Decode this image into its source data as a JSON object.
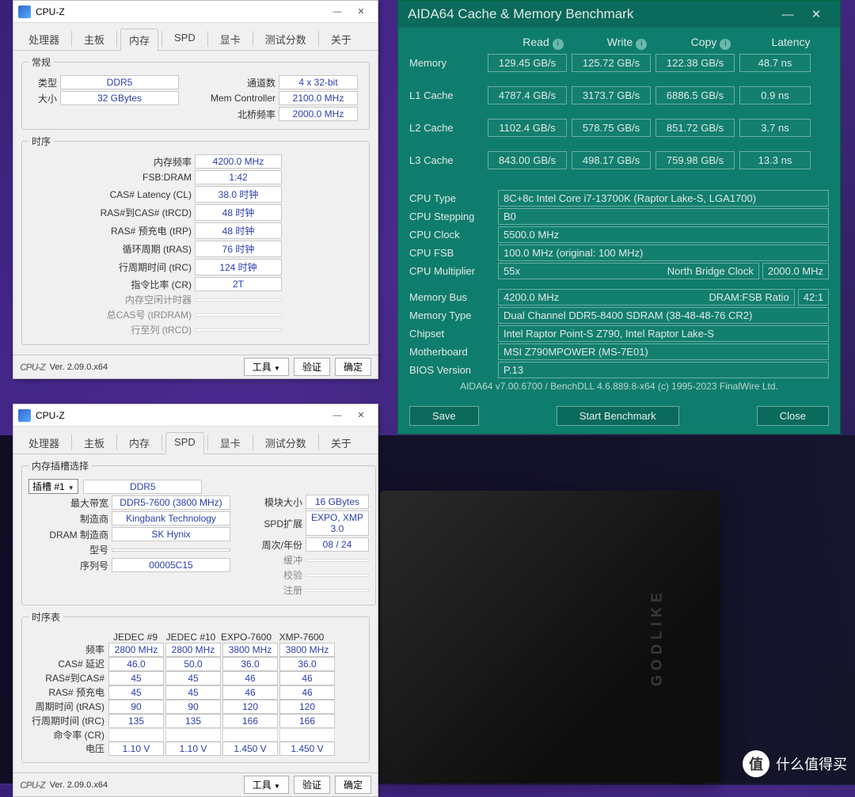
{
  "cpuz1": {
    "title": "CPU-Z",
    "tabs": [
      "处理器",
      "主板",
      "内存",
      "SPD",
      "显卡",
      "测试分数",
      "关于"
    ],
    "active_tab": "内存",
    "general": {
      "legend": "常规",
      "type_lbl": "类型",
      "type": "DDR5",
      "size_lbl": "大小",
      "size": "32 GBytes",
      "channels_lbl": "通道数",
      "channels": "4 x 32-bit",
      "mc_lbl": "Mem Controller",
      "mc": "2100.0 MHz",
      "nb_lbl": "北桥频率",
      "nb": "2000.0 MHz"
    },
    "timings": {
      "legend": "时序",
      "freq_lbl": "内存频率",
      "freq": "4200.0 MHz",
      "fsb_lbl": "FSB:DRAM",
      "fsb": "1:42",
      "cl_lbl": "CAS# Latency (CL)",
      "cl": "38.0 时钟",
      "trcd_lbl": "RAS#到CAS# (tRCD)",
      "trcd": "48 时钟",
      "trp_lbl": "RAS# 预充电 (tRP)",
      "trp": "48 时钟",
      "tras_lbl": "循环周期 (tRAS)",
      "tras": "76 时钟",
      "trc_lbl": "行周期时间 (tRC)",
      "trc": "124 时钟",
      "cr_lbl": "指令比率 (CR)",
      "cr": "2T",
      "idle_lbl": "内存空闲计时器",
      "idle": "",
      "tcas_lbl": "总CAS号 (tRDRAM)",
      "tcas": "",
      "rtc_lbl": "行至列 (tRCD)",
      "rtc": ""
    },
    "footer": {
      "logo": "CPU-Z",
      "ver": "Ver. 2.09.0.x64",
      "tools": "工具",
      "validate": "验证",
      "ok": "确定"
    }
  },
  "cpuz2": {
    "title": "CPU-Z",
    "tabs": [
      "处理器",
      "主板",
      "内存",
      "SPD",
      "显卡",
      "测试分数",
      "关于"
    ],
    "active_tab": "SPD",
    "slot": {
      "legend": "内存插槽选择",
      "slot": "插槽 #1",
      "type": "DDR5",
      "maxbw_lbl": "最大带宽",
      "maxbw": "DDR5-7600 (3800 MHz)",
      "mfg_lbl": "制造商",
      "mfg": "Kingbank Technology",
      "dram_lbl": "DRAM 制造商",
      "dram": "SK Hynix",
      "part_lbl": "型号",
      "part": "",
      "serial_lbl": "序列号",
      "serial": "00005C15",
      "modsize_lbl": "模块大小",
      "modsize": "16 GBytes",
      "spdext_lbl": "SPD扩展",
      "spdext": "EXPO, XMP 3.0",
      "week_lbl": "周次/年份",
      "week": "08 / 24",
      "buf_lbl": "缓冲",
      "ecc_lbl": "校验",
      "reg_lbl": "注册"
    },
    "tt": {
      "legend": "时序表",
      "headers": [
        "JEDEC #9",
        "JEDEC #10",
        "EXPO-7600",
        "XMP-7600"
      ],
      "rows": [
        {
          "n": "频率",
          "v": [
            "2800 MHz",
            "2800 MHz",
            "3800 MHz",
            "3800 MHz"
          ]
        },
        {
          "n": "CAS# 延迟",
          "v": [
            "46.0",
            "50.0",
            "36.0",
            "36.0"
          ]
        },
        {
          "n": "RAS#到CAS#",
          "v": [
            "45",
            "45",
            "46",
            "46"
          ]
        },
        {
          "n": "RAS# 预充电",
          "v": [
            "45",
            "45",
            "46",
            "46"
          ]
        },
        {
          "n": "周期时间 (tRAS)",
          "v": [
            "90",
            "90",
            "120",
            "120"
          ]
        },
        {
          "n": "行周期时间 (tRC)",
          "v": [
            "135",
            "135",
            "166",
            "166"
          ]
        },
        {
          "n": "命令率 (CR)",
          "v": [
            "",
            "",
            "",
            ""
          ]
        },
        {
          "n": "电压",
          "v": [
            "1.10 V",
            "1.10 V",
            "1.450 V",
            "1.450 V"
          ]
        }
      ]
    }
  },
  "aida": {
    "title": "AIDA64 Cache & Memory Benchmark",
    "cols": [
      "Read",
      "Write",
      "Copy",
      "Latency"
    ],
    "rows": [
      {
        "n": "Memory",
        "v": [
          "129.45 GB/s",
          "125.72 GB/s",
          "122.38 GB/s",
          "48.7 ns"
        ]
      },
      {
        "n": "L1 Cache",
        "v": [
          "4787.4 GB/s",
          "3173.7 GB/s",
          "6886.5 GB/s",
          "0.9 ns"
        ]
      },
      {
        "n": "L2 Cache",
        "v": [
          "1102.4 GB/s",
          "578.75 GB/s",
          "851.72 GB/s",
          "3.7 ns"
        ]
      },
      {
        "n": "L3 Cache",
        "v": [
          "843.00 GB/s",
          "498.17 GB/s",
          "759.98 GB/s",
          "13.3 ns"
        ]
      }
    ],
    "info": [
      {
        "n": "CPU Type",
        "v": "8C+8c Intel Core i7-13700K  (Raptor Lake-S, LGA1700)"
      },
      {
        "n": "CPU Stepping",
        "v": "B0"
      },
      {
        "n": "CPU Clock",
        "v": "5500.0 MHz"
      },
      {
        "n": "CPU FSB",
        "v": "100.0 MHz  (original: 100 MHz)"
      },
      {
        "n": "CPU Multiplier",
        "v": "55x",
        "extra_lbl": "North Bridge Clock",
        "extra": "2000.0 MHz"
      }
    ],
    "info2": [
      {
        "n": "Memory Bus",
        "v": "4200.0 MHz",
        "extra_lbl": "DRAM:FSB Ratio",
        "extra": "42:1"
      },
      {
        "n": "Memory Type",
        "v": "Dual Channel DDR5-8400 SDRAM  (38-48-48-76 CR2)"
      },
      {
        "n": "Chipset",
        "v": "Intel Raptor Point-S Z790, Intel Raptor Lake-S"
      },
      {
        "n": "Motherboard",
        "v": "MSI Z790MPOWER (MS-7E01)"
      },
      {
        "n": "BIOS Version",
        "v": "P.13"
      }
    ],
    "ver": "AIDA64 v7.00.6700 / BenchDLL 4.6.889.8-x64  (c) 1995-2023 FinalWire Ltd.",
    "save": "Save",
    "start": "Start Benchmark",
    "close": "Close"
  },
  "wm": "什么值得买"
}
